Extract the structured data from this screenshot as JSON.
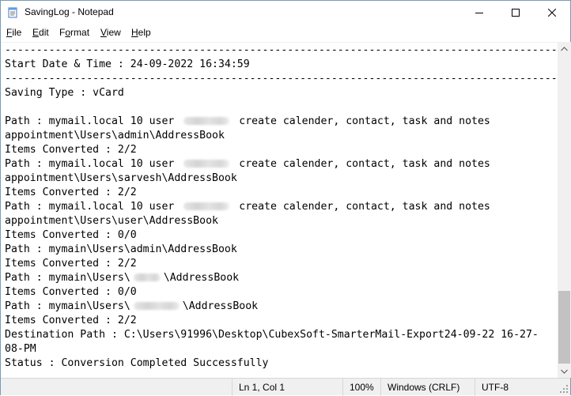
{
  "window": {
    "title": "SavingLog - Notepad"
  },
  "menu": [
    {
      "key": "F",
      "rest": "ile"
    },
    {
      "key": "E",
      "rest": "dit"
    },
    {
      "key": "o",
      "pre": "F",
      "rest": "rmat"
    },
    {
      "key": "V",
      "rest": "iew"
    },
    {
      "key": "H",
      "rest": "elp"
    }
  ],
  "content": {
    "lines": [
      "------------------------------------------------------------------------------------------",
      "Start Date & Time : 24-09-2022 16:34:59",
      "------------------------------------------------------------------------------------------",
      "Saving Type : vCard",
      "",
      [
        "Path : mymail.local 10 user ",
        "",
        " create calender, contact, task and notes"
      ],
      "appointment\\Users\\admin\\AddressBook",
      "Items Converted : 2/2",
      [
        "Path : mymail.local 10 user ",
        "",
        " create calender, contact, task and notes"
      ],
      "appointment\\Users\\sarvesh\\AddressBook",
      "Items Converted : 2/2",
      [
        "Path : mymail.local 10 user ",
        "",
        " create calender, contact, task and notes"
      ],
      "appointment\\Users\\user\\AddressBook",
      "Items Converted : 0/0",
      "Path : mymain\\Users\\admin\\AddressBook",
      "Items Converted : 2/2",
      [
        "Path : mymain\\Users\\",
        "short",
        "\\AddressBook"
      ],
      "Items Converted : 0/0",
      [
        "Path : mymain\\Users\\",
        "",
        "\\AddressBook"
      ],
      "Items Converted : 2/2",
      "Destination Path : C:\\Users\\91996\\Desktop\\CubexSoft-SmarterMail-Export24-09-22 16-27-",
      "08-PM",
      "Status : Conversion Completed Successfully"
    ]
  },
  "status": {
    "position": "Ln 1, Col 1",
    "zoom": "100%",
    "line_ending": "Windows (CRLF)",
    "encoding": "UTF-8"
  }
}
